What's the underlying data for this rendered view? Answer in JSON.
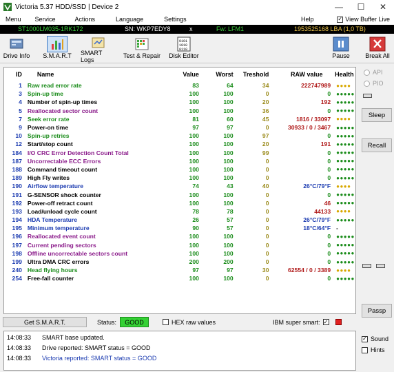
{
  "window": {
    "title": "Victoria 5.37 HDD/SSD | Device 2",
    "minimize": "—",
    "maximize": "☐",
    "close": "✕"
  },
  "menu": {
    "items": [
      "Menu",
      "Service",
      "Actions",
      "Language",
      "Settings"
    ],
    "help": "Help",
    "view_buffer": "View Buffer Live",
    "view_buffer_checked": "✓"
  },
  "drive": {
    "model": "ST1000LM035-1RK172",
    "serial": "SN: WKP7EDY8",
    "x": "x",
    "firmware": "Fw: LFM1",
    "lba": "1953525168 LBA (1,0 TB)"
  },
  "toolbar": [
    {
      "label": "Drive Info",
      "icon": "drive-info-icon"
    },
    {
      "label": "S.M.A.R.T",
      "icon": "smart-chart-icon"
    },
    {
      "label": "SMART Logs",
      "icon": "smart-logs-icon"
    },
    {
      "label": "Test & Repair",
      "icon": "test-repair-icon"
    },
    {
      "label": "Disk Editor",
      "icon": "disk-editor-icon"
    },
    {
      "label": "Pause",
      "icon": "pause-icon"
    },
    {
      "label": "Break All",
      "icon": "break-all-icon"
    }
  ],
  "table": {
    "headers": [
      "ID",
      "Name",
      "Value",
      "Worst",
      "Treshold",
      "RAW value",
      "Health"
    ],
    "rows": [
      {
        "id": "1",
        "name": "Raw read error rate",
        "value": "83",
        "worst": "64",
        "tresh": "34",
        "raw": "222747989",
        "health": "●●●●",
        "name_color": "#1a8c1a",
        "health_color": "#d8a800"
      },
      {
        "id": "3",
        "name": "Spin-up time",
        "value": "100",
        "worst": "100",
        "tresh": "0",
        "raw": "0",
        "health": "●●●●●",
        "name_color": "#1a8c1a",
        "health_color": "#1a8c1a"
      },
      {
        "id": "4",
        "name": "Number of spin-up times",
        "value": "100",
        "worst": "100",
        "tresh": "20",
        "raw": "192",
        "health": "●●●●●",
        "name_color": "#000000",
        "health_color": "#1a8c1a"
      },
      {
        "id": "5",
        "name": "Reallocated sector count",
        "value": "100",
        "worst": "100",
        "tresh": "36",
        "raw": "0",
        "health": "●●●●●",
        "name_color": "#8a1a8a",
        "health_color": "#1a8c1a"
      },
      {
        "id": "7",
        "name": "Seek error rate",
        "value": "81",
        "worst": "60",
        "tresh": "45",
        "raw": "1816 / 33097",
        "health": "●●●●",
        "name_color": "#1a8c1a",
        "health_color": "#d8a800"
      },
      {
        "id": "9",
        "name": "Power-on time",
        "value": "97",
        "worst": "97",
        "tresh": "0",
        "raw": "30933 / 0 / 3467",
        "health": "●●●●●",
        "name_color": "#000000",
        "health_color": "#1a8c1a"
      },
      {
        "id": "10",
        "name": "Spin-up retries",
        "value": "100",
        "worst": "100",
        "tresh": "97",
        "raw": "0",
        "health": "●●●●●",
        "name_color": "#1a8c1a",
        "health_color": "#1a8c1a"
      },
      {
        "id": "12",
        "name": "Start/stop count",
        "value": "100",
        "worst": "100",
        "tresh": "20",
        "raw": "191",
        "health": "●●●●●",
        "name_color": "#000000",
        "health_color": "#1a8c1a"
      },
      {
        "id": "184",
        "name": "I/O CRC Error Detection Count Total",
        "value": "100",
        "worst": "100",
        "tresh": "99",
        "raw": "0",
        "health": "●●●●●",
        "name_color": "#8a1a8a",
        "health_color": "#1a8c1a"
      },
      {
        "id": "187",
        "name": "Uncorrectable ECC Errors",
        "value": "100",
        "worst": "100",
        "tresh": "0",
        "raw": "0",
        "health": "●●●●●",
        "name_color": "#8a1a8a",
        "health_color": "#1a8c1a"
      },
      {
        "id": "188",
        "name": "Command timeout count",
        "value": "100",
        "worst": "100",
        "tresh": "0",
        "raw": "0",
        "health": "●●●●●",
        "name_color": "#000000",
        "health_color": "#1a8c1a"
      },
      {
        "id": "189",
        "name": "High Fly writes",
        "value": "100",
        "worst": "100",
        "tresh": "0",
        "raw": "0",
        "health": "●●●●●",
        "name_color": "#000000",
        "health_color": "#1a8c1a"
      },
      {
        "id": "190",
        "name": "Airflow temperature",
        "value": "74",
        "worst": "43",
        "tresh": "40",
        "raw": "26°C/79°F",
        "health": "●●●●",
        "name_color": "#1a3ab0",
        "health_color": "#d8a800"
      },
      {
        "id": "191",
        "name": "G-SENSOR shock counter",
        "value": "100",
        "worst": "100",
        "tresh": "0",
        "raw": "0",
        "health": "●●●●●",
        "name_color": "#000000",
        "health_color": "#1a8c1a"
      },
      {
        "id": "192",
        "name": "Power-off retract count",
        "value": "100",
        "worst": "100",
        "tresh": "0",
        "raw": "46",
        "health": "●●●●●",
        "name_color": "#000000",
        "health_color": "#1a8c1a"
      },
      {
        "id": "193",
        "name": "Load/unload cycle count",
        "value": "78",
        "worst": "78",
        "tresh": "0",
        "raw": "44133",
        "health": "●●●●",
        "name_color": "#000000",
        "health_color": "#d8a800"
      },
      {
        "id": "194",
        "name": "HDA Temperature",
        "value": "26",
        "worst": "57",
        "tresh": "0",
        "raw": "26°C/79°F",
        "health": "●●●●●",
        "name_color": "#1a3ab0",
        "health_color": "#1a8c1a"
      },
      {
        "id": "195",
        "name": "Minimum temperature",
        "value": "90",
        "worst": "57",
        "tresh": "0",
        "raw": "18°C/64°F",
        "health": "-",
        "name_color": "#1a3ab0",
        "health_color": "#000000"
      },
      {
        "id": "196",
        "name": "Reallocated event count",
        "value": "100",
        "worst": "100",
        "tresh": "0",
        "raw": "0",
        "health": "●●●●●",
        "name_color": "#8a1a8a",
        "health_color": "#1a8c1a"
      },
      {
        "id": "197",
        "name": "Current pending sectors",
        "value": "100",
        "worst": "100",
        "tresh": "0",
        "raw": "0",
        "health": "●●●●●",
        "name_color": "#8a1a8a",
        "health_color": "#1a8c1a"
      },
      {
        "id": "198",
        "name": "Offline uncorrectable sectors count",
        "value": "100",
        "worst": "100",
        "tresh": "0",
        "raw": "0",
        "health": "●●●●●",
        "name_color": "#8a1a8a",
        "health_color": "#1a8c1a"
      },
      {
        "id": "199",
        "name": "Ultra DMA CRC errors",
        "value": "200",
        "worst": "200",
        "tresh": "0",
        "raw": "0",
        "health": "●●●●●",
        "name_color": "#000000",
        "health_color": "#1a8c1a"
      },
      {
        "id": "240",
        "name": "Head flying hours",
        "value": "97",
        "worst": "97",
        "tresh": "30",
        "raw": "62554 / 0 / 3389",
        "health": "●●●●",
        "name_color": "#1a8c1a",
        "health_color": "#d8a800"
      },
      {
        "id": "254",
        "name": "Free-fall counter",
        "value": "100",
        "worst": "100",
        "tresh": "0",
        "raw": "0",
        "health": "●●●●●",
        "name_color": "#000000",
        "health_color": "#1a8c1a"
      }
    ]
  },
  "right_panel": {
    "api": "API",
    "pio": "PIO",
    "sleep": "Sleep",
    "recall": "Recall",
    "passp": "Passp"
  },
  "status": {
    "get_smart": "Get S.M.A.R.T.",
    "status_label": "Status:",
    "status_value": "GOOD",
    "hex_raw": "HEX raw values",
    "ibm_super": "IBM super smart:",
    "ibm_checked": "✓"
  },
  "log": [
    {
      "time": "14:08:33",
      "msg": "SMART base updated.",
      "color": "#000000"
    },
    {
      "time": "14:08:33",
      "msg": "Drive reported: SMART status = GOOD",
      "color": "#000000"
    },
    {
      "time": "14:08:33",
      "msg": "Victoria reported: SMART status = GOOD",
      "color": "#1a3ab0"
    }
  ],
  "bottom_right": {
    "sound": "Sound",
    "sound_checked": "✓",
    "hints": "Hints"
  },
  "colors": {
    "good_green": "#34d134",
    "drive_bar_model": "#3fd23f",
    "drive_bar_serial": "#ffffff",
    "drive_bar_fw": "#3fd23f",
    "drive_bar_lba": "#f2c94c"
  }
}
